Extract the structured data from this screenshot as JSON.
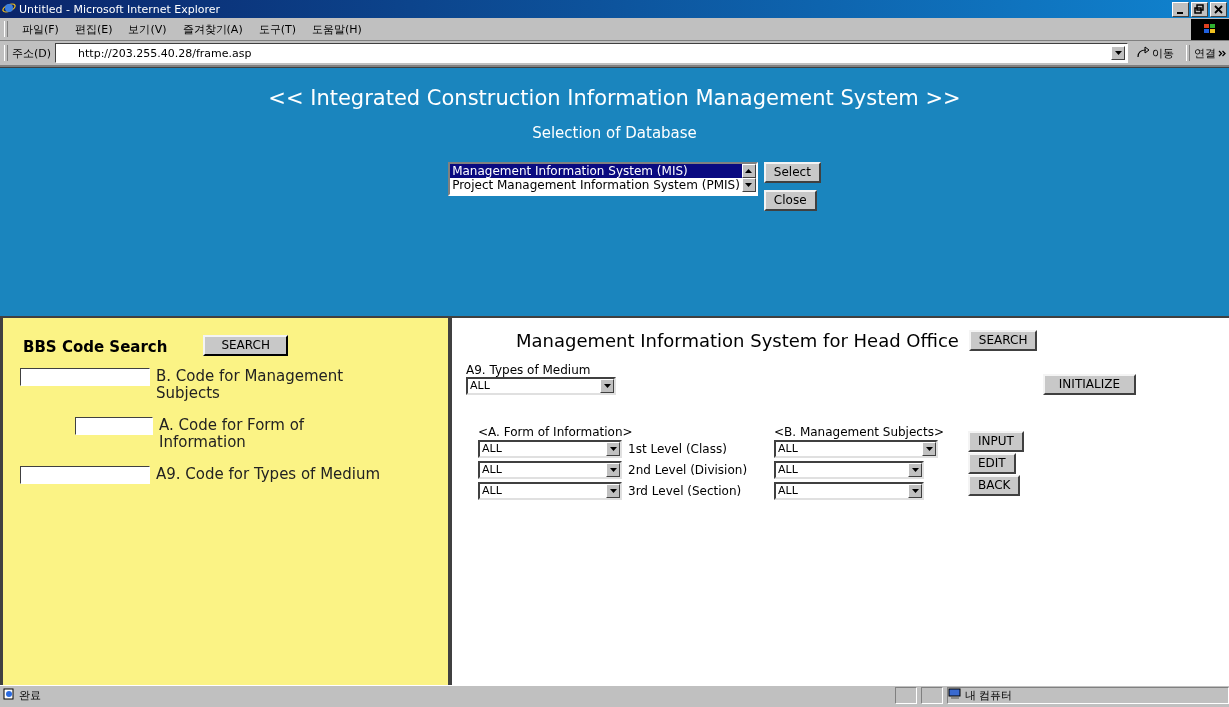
{
  "window": {
    "title": "Untitled - Microsoft Internet Explorer"
  },
  "menu": [
    "파일(F)",
    "편집(E)",
    "보기(V)",
    "즐겨찾기(A)",
    "도구(T)",
    "도움말(H)"
  ],
  "address_bar": {
    "label": "주소(D)",
    "url": "http://203.255.40.28/frame.asp",
    "go": "이동",
    "links": "연결"
  },
  "header": {
    "title": "<< Integrated Construction Information Management System >>",
    "subtitle": "Selection of Database",
    "databases": [
      {
        "label": "Management Information System (MIS)",
        "selected": true
      },
      {
        "label": "Project Management Information System (PMIS)",
        "selected": false
      }
    ],
    "buttons": [
      "Select",
      "Close"
    ]
  },
  "left_panel": {
    "title": "BBS Code Search",
    "search_button": "SEARCH",
    "fields": [
      {
        "label": "B. Code for Management Subjects",
        "kind": "wide"
      },
      {
        "label": "A. Code for Form of Information",
        "kind": "indented"
      },
      {
        "label": "A9. Code for Types of Medium",
        "kind": "wide"
      }
    ]
  },
  "right_panel": {
    "title": "Management Information System for Head Office",
    "search_button": "SEARCH",
    "medium": {
      "label": "A9. Types of Medium",
      "value": "ALL"
    },
    "initialize_button": "INITIALIZE",
    "form_header": "<A. Form of Information>",
    "subjects_header": "<B. Management Subjects>",
    "levels": [
      {
        "form_value": "ALL",
        "label": "1st Level (Class)",
        "subject_value": "ALL"
      },
      {
        "form_value": "ALL",
        "label": "2nd Level (Division)",
        "subject_value": "ALL"
      },
      {
        "form_value": "ALL",
        "label": "3rd Level (Section)",
        "subject_value": "ALL"
      }
    ],
    "buttons": [
      "INPUT",
      "EDIT",
      "BACK"
    ]
  },
  "status_bar": {
    "text": "완료",
    "zone": "내 컴퓨터"
  }
}
